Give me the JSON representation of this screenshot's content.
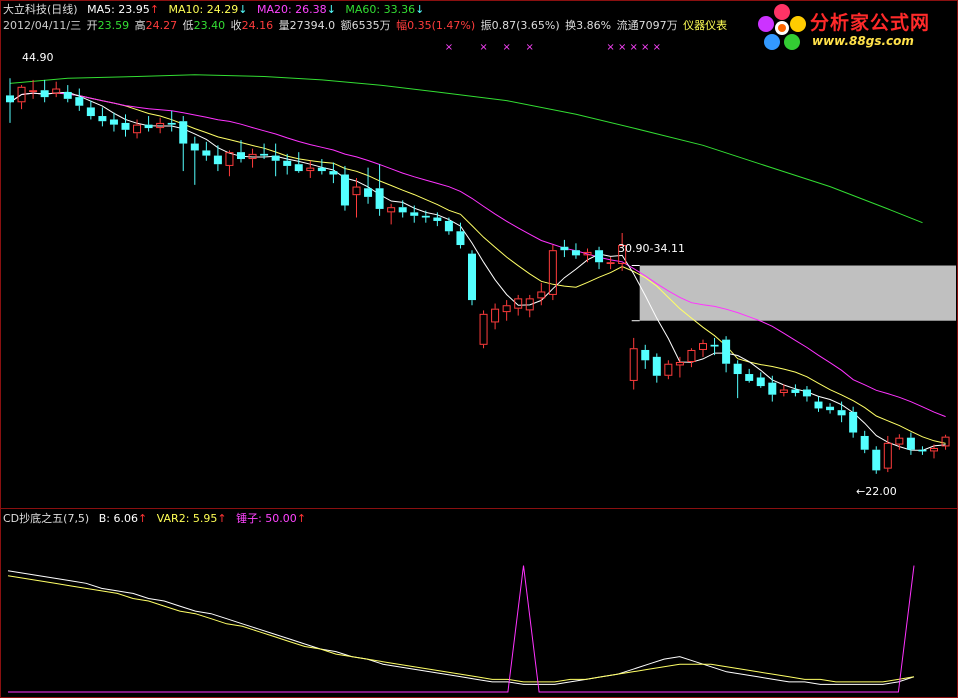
{
  "header": {
    "stock": "大立科技(日线)",
    "ma5": "MA5: 23.95",
    "ma10": "MA10: 24.29",
    "ma20": "MA20: 26.38",
    "ma60": "MA60: 33.36",
    "up_arrow": "↑",
    "down_arrow": "↓"
  },
  "info": {
    "date": "2012/04/11/三",
    "open_label": "开",
    "open": "23.59",
    "high_label": "高",
    "high": "24.27",
    "low_label": "低",
    "low": "23.40",
    "close_label": "收",
    "close": "24.16",
    "volume": "量27394.0",
    "amount": "额6535万",
    "change": "幅0.35(1.47%)",
    "amplitude": "振0.87(3.65%)",
    "turnover": "换3.86%",
    "float": "流通7097万",
    "industry": "仪器仪表"
  },
  "sub_header": {
    "name": "CD抄底之五(7,5)",
    "b": "B: 6.06",
    "var2": "VAR2: 5.95",
    "hammer": "锤子: 50.00",
    "up_arrow": "↑"
  },
  "logo": {
    "title": "分析家公式网",
    "url": "www.88gs.com"
  },
  "annotations": {
    "high_price": "44.90",
    "low_price": "←22.00",
    "gap_range": "30.90-34.11"
  },
  "colors": {
    "up_candle": "#ff3c3c",
    "down_candle": "#54ffff",
    "ma5": "#ffffff",
    "ma10": "#ffff66",
    "ma20": "#ff33ff",
    "ma60": "#33dd33",
    "gap_box": "#c0c0c0",
    "marker": "#ff44ff",
    "border": "#8a1010"
  },
  "chart_data": [
    {
      "type": "candlestick",
      "title": "大立科技(日线)",
      "ylim": [
        21,
        46
      ],
      "candles": [
        {
          "o": 44.0,
          "h": 45.0,
          "l": 42.4,
          "c": 43.6
        },
        {
          "o": 43.6,
          "h": 44.6,
          "l": 43.2,
          "c": 44.5
        },
        {
          "o": 44.2,
          "h": 44.9,
          "l": 43.8,
          "c": 44.3
        },
        {
          "o": 44.3,
          "h": 44.9,
          "l": 43.6,
          "c": 43.9
        },
        {
          "o": 44.1,
          "h": 44.8,
          "l": 43.9,
          "c": 44.4
        },
        {
          "o": 44.2,
          "h": 44.6,
          "l": 43.6,
          "c": 43.8
        },
        {
          "o": 43.9,
          "h": 44.4,
          "l": 43.1,
          "c": 43.4
        },
        {
          "o": 43.3,
          "h": 43.7,
          "l": 42.6,
          "c": 42.8
        },
        {
          "o": 42.8,
          "h": 43.3,
          "l": 42.2,
          "c": 42.5
        },
        {
          "o": 42.6,
          "h": 43.0,
          "l": 41.9,
          "c": 42.3
        },
        {
          "o": 42.4,
          "h": 42.9,
          "l": 41.6,
          "c": 42.0
        },
        {
          "o": 41.8,
          "h": 42.6,
          "l": 41.5,
          "c": 42.3
        },
        {
          "o": 42.3,
          "h": 42.8,
          "l": 41.9,
          "c": 42.1
        },
        {
          "o": 42.1,
          "h": 42.7,
          "l": 41.8,
          "c": 42.4
        },
        {
          "o": 42.4,
          "h": 43.1,
          "l": 41.9,
          "c": 42.3
        },
        {
          "o": 42.5,
          "h": 42.8,
          "l": 39.6,
          "c": 41.2
        },
        {
          "o": 41.2,
          "h": 41.6,
          "l": 38.8,
          "c": 40.8
        },
        {
          "o": 40.8,
          "h": 41.3,
          "l": 40.2,
          "c": 40.5
        },
        {
          "o": 40.5,
          "h": 41.1,
          "l": 39.6,
          "c": 40.0
        },
        {
          "o": 39.9,
          "h": 40.8,
          "l": 39.3,
          "c": 40.7
        },
        {
          "o": 40.7,
          "h": 41.4,
          "l": 40.1,
          "c": 40.3
        },
        {
          "o": 40.3,
          "h": 40.9,
          "l": 39.8,
          "c": 40.6
        },
        {
          "o": 40.6,
          "h": 41.2,
          "l": 40.3,
          "c": 40.5
        },
        {
          "o": 40.5,
          "h": 41.2,
          "l": 39.3,
          "c": 40.2
        },
        {
          "o": 40.2,
          "h": 40.6,
          "l": 39.4,
          "c": 39.9
        },
        {
          "o": 40.0,
          "h": 40.7,
          "l": 39.5,
          "c": 39.6
        },
        {
          "o": 39.6,
          "h": 40.2,
          "l": 39.2,
          "c": 39.8
        },
        {
          "o": 39.8,
          "h": 40.3,
          "l": 39.4,
          "c": 39.6
        },
        {
          "o": 39.6,
          "h": 40.1,
          "l": 38.9,
          "c": 39.4
        },
        {
          "o": 39.4,
          "h": 39.9,
          "l": 37.3,
          "c": 37.6
        },
        {
          "o": 38.2,
          "h": 39.2,
          "l": 36.9,
          "c": 38.7
        },
        {
          "o": 38.6,
          "h": 39.8,
          "l": 37.7,
          "c": 38.1
        },
        {
          "o": 38.6,
          "h": 40.0,
          "l": 37.0,
          "c": 37.4
        },
        {
          "o": 37.2,
          "h": 37.7,
          "l": 36.5,
          "c": 37.5
        },
        {
          "o": 37.5,
          "h": 37.9,
          "l": 36.9,
          "c": 37.2
        },
        {
          "o": 37.2,
          "h": 37.6,
          "l": 36.6,
          "c": 37.0
        },
        {
          "o": 37.0,
          "h": 37.3,
          "l": 36.6,
          "c": 36.9
        },
        {
          "o": 36.9,
          "h": 37.2,
          "l": 36.4,
          "c": 36.7
        },
        {
          "o": 36.7,
          "h": 36.9,
          "l": 35.9,
          "c": 36.1
        },
        {
          "o": 36.1,
          "h": 36.6,
          "l": 35.1,
          "c": 35.3
        },
        {
          "o": 34.8,
          "h": 35.0,
          "l": 31.8,
          "c": 32.1
        },
        {
          "o": 29.5,
          "h": 31.5,
          "l": 29.3,
          "c": 31.3
        },
        {
          "o": 30.8,
          "h": 31.9,
          "l": 30.4,
          "c": 31.6
        },
        {
          "o": 31.4,
          "h": 32.1,
          "l": 30.9,
          "c": 31.8
        },
        {
          "o": 31.6,
          "h": 32.4,
          "l": 31.2,
          "c": 32.2
        },
        {
          "o": 31.5,
          "h": 32.4,
          "l": 31.1,
          "c": 32.2
        },
        {
          "o": 32.2,
          "h": 33.1,
          "l": 31.8,
          "c": 32.6
        },
        {
          "o": 32.4,
          "h": 35.3,
          "l": 32.1,
          "c": 35.0
        },
        {
          "o": 35.2,
          "h": 35.6,
          "l": 34.6,
          "c": 35.0
        },
        {
          "o": 35.0,
          "h": 35.4,
          "l": 34.5,
          "c": 34.7
        },
        {
          "o": 34.7,
          "h": 35.1,
          "l": 34.3,
          "c": 34.9
        },
        {
          "o": 35.0,
          "h": 35.2,
          "l": 33.9,
          "c": 34.3
        },
        {
          "o": 34.2,
          "h": 34.6,
          "l": 33.9,
          "c": 34.3
        },
        {
          "o": 34.2,
          "h": 36.0,
          "l": 33.8,
          "c": 35.3
        },
        {
          "o": 27.4,
          "h": 29.9,
          "l": 26.9,
          "c": 29.3
        },
        {
          "o": 29.2,
          "h": 29.5,
          "l": 28.1,
          "c": 28.6
        },
        {
          "o": 28.8,
          "h": 29.0,
          "l": 27.3,
          "c": 27.7
        },
        {
          "o": 27.7,
          "h": 28.6,
          "l": 27.5,
          "c": 28.4
        },
        {
          "o": 28.3,
          "h": 28.8,
          "l": 27.6,
          "c": 28.5
        },
        {
          "o": 28.5,
          "h": 29.3,
          "l": 28.2,
          "c": 29.2
        },
        {
          "o": 29.2,
          "h": 29.8,
          "l": 28.8,
          "c": 29.6
        },
        {
          "o": 29.5,
          "h": 29.9,
          "l": 28.9,
          "c": 29.4
        },
        {
          "o": 29.8,
          "h": 30.0,
          "l": 27.9,
          "c": 28.4
        },
        {
          "o": 28.4,
          "h": 28.6,
          "l": 26.4,
          "c": 27.8
        },
        {
          "o": 27.8,
          "h": 28.1,
          "l": 27.3,
          "c": 27.4
        },
        {
          "o": 27.6,
          "h": 27.9,
          "l": 27.0,
          "c": 27.1
        },
        {
          "o": 27.3,
          "h": 27.7,
          "l": 26.2,
          "c": 26.6
        },
        {
          "o": 26.7,
          "h": 27.2,
          "l": 26.5,
          "c": 26.9
        },
        {
          "o": 26.9,
          "h": 27.2,
          "l": 26.5,
          "c": 26.7
        },
        {
          "o": 26.9,
          "h": 27.1,
          "l": 26.2,
          "c": 26.5
        },
        {
          "o": 26.2,
          "h": 26.5,
          "l": 25.6,
          "c": 25.8
        },
        {
          "o": 25.9,
          "h": 26.1,
          "l": 25.5,
          "c": 25.7
        },
        {
          "o": 25.7,
          "h": 26.2,
          "l": 25.0,
          "c": 25.4
        },
        {
          "o": 25.6,
          "h": 25.9,
          "l": 24.1,
          "c": 24.4
        },
        {
          "o": 24.2,
          "h": 24.5,
          "l": 23.2,
          "c": 23.4
        },
        {
          "o": 23.4,
          "h": 23.6,
          "l": 22.0,
          "c": 22.2
        },
        {
          "o": 22.3,
          "h": 24.2,
          "l": 22.1,
          "c": 23.8
        },
        {
          "o": 23.7,
          "h": 24.3,
          "l": 23.4,
          "c": 24.1
        },
        {
          "o": 24.1,
          "h": 24.4,
          "l": 23.1,
          "c": 23.4
        },
        {
          "o": 23.4,
          "h": 23.6,
          "l": 23.1,
          "c": 23.3
        },
        {
          "o": 23.3,
          "h": 23.7,
          "l": 22.9,
          "c": 23.5
        },
        {
          "o": 23.59,
          "h": 24.27,
          "l": 23.4,
          "c": 24.16
        }
      ],
      "ma60": [
        [
          0,
          44.7
        ],
        [
          5,
          45.0
        ],
        [
          11,
          45.1
        ],
        [
          16,
          45.2
        ],
        [
          22,
          45.1
        ],
        [
          27,
          44.9
        ],
        [
          32,
          44.6
        ],
        [
          37,
          44.2
        ],
        [
          43,
          43.7
        ],
        [
          49,
          42.9
        ],
        [
          54,
          42.1
        ],
        [
          60,
          41.1
        ],
        [
          65,
          40.0
        ],
        [
          71,
          38.7
        ],
        [
          76,
          37.4
        ],
        [
          79,
          36.6
        ]
      ],
      "markers_x": [
        38,
        41,
        43,
        45,
        52,
        53,
        54,
        55,
        56
      ],
      "gap_zone": {
        "low": 30.9,
        "high": 34.11
      },
      "high_label_value": 44.9,
      "low_label_value": 22.0
    },
    {
      "type": "line",
      "title": "CD抄底之五(7,5)",
      "ylim": [
        0,
        55
      ],
      "series": [
        {
          "name": "B",
          "values": [
            48,
            47,
            46,
            45,
            44,
            43,
            41,
            40,
            39,
            37,
            36,
            34,
            32,
            31,
            29,
            27,
            25,
            23,
            21,
            19,
            17,
            16,
            14,
            13,
            11,
            10,
            9,
            8,
            7,
            6,
            5,
            4,
            4,
            3,
            3,
            3,
            4,
            5,
            6,
            7,
            9,
            11,
            13,
            14,
            12,
            10,
            8,
            7,
            6,
            5,
            4,
            4,
            3,
            3,
            3,
            3,
            3,
            4,
            6
          ]
        },
        {
          "name": "VAR2",
          "values": [
            46,
            45,
            44,
            43,
            42,
            41,
            40,
            39,
            37,
            36,
            34,
            32,
            31,
            29,
            27,
            26,
            24,
            22,
            20,
            18,
            17,
            15,
            14,
            13,
            12,
            11,
            10,
            9,
            8,
            7,
            6,
            5,
            5,
            4,
            4,
            4,
            5,
            5,
            6,
            7,
            8,
            9,
            10,
            11,
            11,
            11,
            10,
            9,
            8,
            7,
            6,
            5,
            5,
            4,
            4,
            4,
            4,
            5,
            6
          ]
        },
        {
          "name": "锤子",
          "values": [
            0,
            0,
            0,
            0,
            0,
            0,
            0,
            0,
            0,
            0,
            0,
            0,
            0,
            0,
            0,
            0,
            0,
            0,
            0,
            0,
            0,
            0,
            0,
            0,
            0,
            0,
            0,
            0,
            0,
            0,
            0,
            0,
            0,
            50,
            0,
            0,
            0,
            0,
            0,
            0,
            0,
            0,
            0,
            0,
            0,
            0,
            0,
            0,
            0,
            0,
            0,
            0,
            0,
            0,
            0,
            0,
            0,
            0,
            50
          ]
        }
      ]
    }
  ]
}
